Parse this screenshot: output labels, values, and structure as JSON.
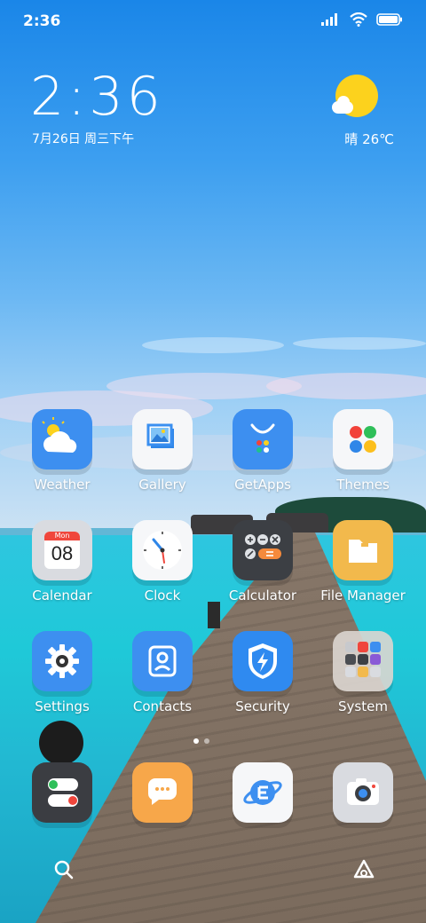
{
  "status_bar": {
    "time": "2:36",
    "icons": [
      "signal-icon",
      "wifi-icon",
      "battery-icon"
    ]
  },
  "widget": {
    "clock": "2:36",
    "date": "7月26日 周三下午",
    "weather_icon": "sun-cloud-icon",
    "weather": "晴 26℃"
  },
  "apps": [
    {
      "label": "Weather",
      "icon": "weather-icon"
    },
    {
      "label": "Gallery",
      "icon": "gallery-icon"
    },
    {
      "label": "GetApps",
      "icon": "getapps-icon"
    },
    {
      "label": "Themes",
      "icon": "themes-icon"
    },
    {
      "label": "Calendar",
      "icon": "calendar-icon",
      "calendar_month": "Mon",
      "calendar_day": "08"
    },
    {
      "label": "Clock",
      "icon": "clock-icon"
    },
    {
      "label": "Calculator",
      "icon": "calculator-icon"
    },
    {
      "label": "File Manager",
      "icon": "file-manager-icon"
    },
    {
      "label": "Settings",
      "icon": "settings-icon"
    },
    {
      "label": "Contacts",
      "icon": "contacts-icon"
    },
    {
      "label": "Security",
      "icon": "security-icon"
    },
    {
      "label": "System",
      "icon": "system-folder-icon"
    }
  ],
  "dock": [
    {
      "icon": "phone-icon"
    },
    {
      "icon": "messages-icon"
    },
    {
      "icon": "browser-icon"
    },
    {
      "icon": "camera-icon"
    }
  ],
  "page_indicator": {
    "pages": 2,
    "current": 1
  },
  "bottom_bar": {
    "left_icon": "search-icon",
    "right_icon": "app-drawer-icon"
  },
  "colors": {
    "weather": "#3d8ff0",
    "getapps": "#3d8ff0",
    "settings": "#3d8ff0",
    "contacts": "#3d8ff0",
    "security": "#2f8af0",
    "calculator": "#3c3f44",
    "file_manager": "#f2b94c",
    "messages": "#f7a74a",
    "phone": "#3b3d42"
  }
}
